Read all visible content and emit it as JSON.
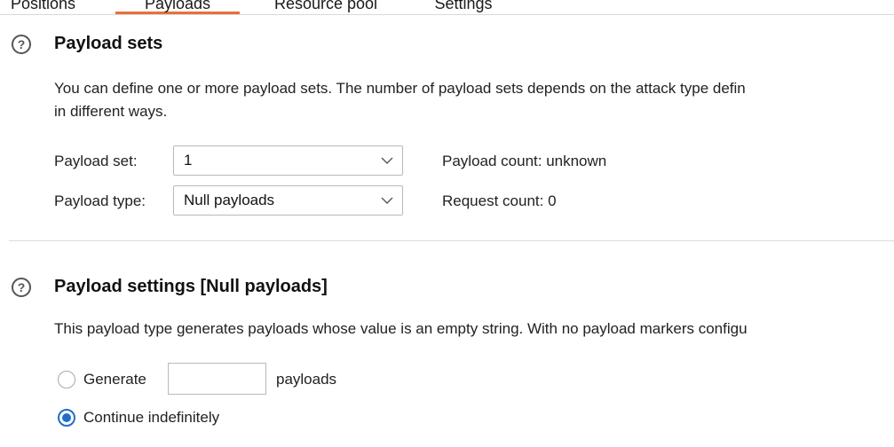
{
  "tabs": [
    {
      "label": "Positions"
    },
    {
      "label": "Payloads",
      "active": true
    },
    {
      "label": "Resource pool"
    },
    {
      "label": "Settings"
    }
  ],
  "accent_color": "#e8703a",
  "radio_color": "#1f6fc9",
  "payload_sets": {
    "help_icon": "?",
    "title": "Payload sets",
    "description_line1": "You can define one or more payload sets. The number of payload sets depends on the attack type defin",
    "description_line2": "in different ways.",
    "payload_set_label": "Payload set:",
    "payload_set_value": "1",
    "payload_type_label": "Payload type:",
    "payload_type_value": "Null payloads",
    "payload_count": "Payload count:  unknown",
    "request_count": "Request count:  0"
  },
  "payload_settings": {
    "help_icon": "?",
    "title": "Payload settings [Null payloads]",
    "description": "This payload type generates payloads whose value is an empty string. With no payload markers configu",
    "generate_label": "Generate",
    "generate_value": "",
    "payloads_suffix": "payloads",
    "continue_label": "Continue indefinitely",
    "selected_option": "Continue indefinitely"
  }
}
